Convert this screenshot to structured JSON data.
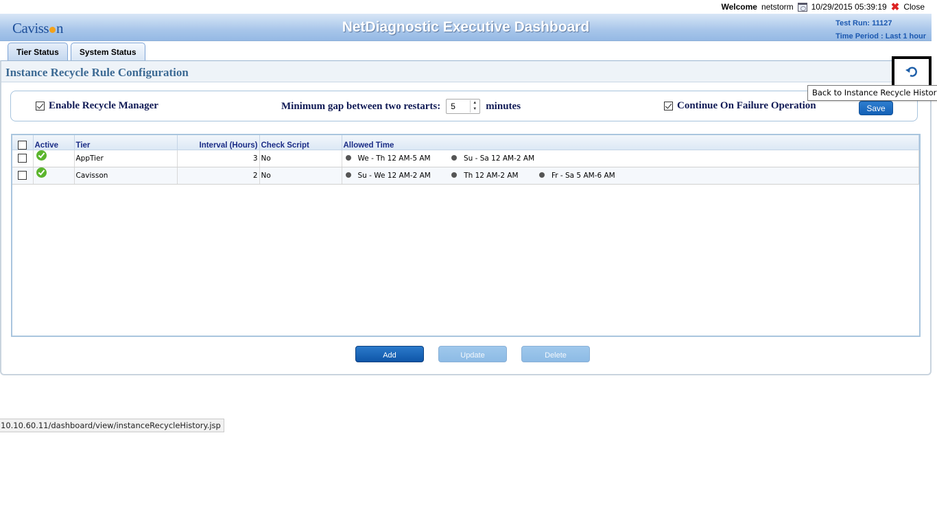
{
  "userbar": {
    "welcome_label": "Welcome",
    "username": "netstorm",
    "datetime": "10/29/2015 05:39:19",
    "close_label": "Close"
  },
  "header": {
    "logo_text_a": "Caviss",
    "logo_text_b": "n",
    "title": "NetDiagnostic Executive Dashboard",
    "test_run": "Test Run: 11127",
    "time_period": "Time Period : Last 1 hour"
  },
  "tabs": [
    {
      "label": "Tier Status"
    },
    {
      "label": "System Status"
    }
  ],
  "panel": {
    "title": "Instance Recycle Rule Configuration",
    "back_tooltip": "Back to Instance Recycle History"
  },
  "settings": {
    "enable_label": "Enable Recycle Manager",
    "enable_checked": true,
    "gap_label": "Minimum gap between two restarts:",
    "gap_value": "5",
    "gap_unit": "minutes",
    "continue_label": "Continue On Failure Operation",
    "continue_checked": true,
    "save_label": "Save"
  },
  "table": {
    "columns": {
      "active": "Active",
      "tier": "Tier",
      "interval": "Interval (Hours)",
      "check_script": "Check Script",
      "allowed_time": "Allowed Time"
    },
    "rows": [
      {
        "tier": "AppTier",
        "interval": "3",
        "check_script": "No",
        "allowed": [
          "We - Th 12 AM-5 AM",
          "Su - Sa 12 AM-2 AM"
        ]
      },
      {
        "tier": "Cavisson",
        "interval": "2",
        "check_script": "No",
        "allowed": [
          "Su - We 12 AM-2 AM",
          "Th 12 AM-2 AM",
          "Fr - Sa 5 AM-6 AM"
        ]
      }
    ]
  },
  "actions": {
    "add": "Add",
    "update": "Update",
    "delete": "Delete"
  },
  "status_url": "10.10.60.11/dashboard/view/instanceRecycleHistory.jsp",
  "colors": {
    "brand_blue": "#1360b6",
    "header_title": "#ffffff",
    "panel_title": "#3c6a94",
    "active_ok": "#5bb52d"
  }
}
